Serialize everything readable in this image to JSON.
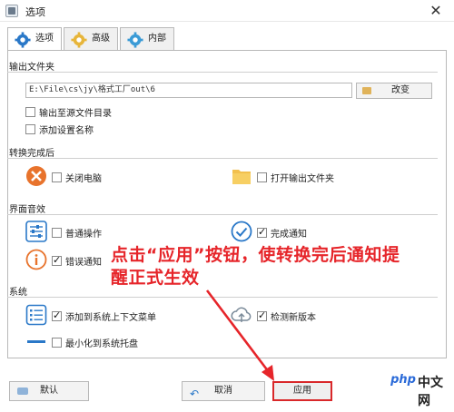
{
  "window": {
    "title": "选项",
    "close_glyph": "✕"
  },
  "tabs": [
    {
      "label": "选项",
      "icon": "gear-icon",
      "active": true
    },
    {
      "label": "高级",
      "icon": "advanced-gear-icon",
      "active": false
    },
    {
      "label": "内部",
      "icon": "internal-gear-icon",
      "active": false
    }
  ],
  "output_folder": {
    "title": "输出文件夹",
    "path_value": "E:\\File\\cs\\jy\\格式工厂out\\6",
    "browse_label": "改变",
    "opt_source_dir": "输出至源文件目录",
    "opt_add_setting_name": "添加设置名称"
  },
  "after_convert": {
    "title": "转换完成后",
    "shutdown": "关闭电脑",
    "open_folder": "打开输出文件夹"
  },
  "ui_sound": {
    "title": "界面音效",
    "normal_op": "普通操作",
    "done_notify": "完成通知",
    "error_notify": "错误通知"
  },
  "system": {
    "title": "系统",
    "add_context_menu": "添加到系统上下文菜单",
    "check_update": "检测新版本",
    "minimize_tray": "最小化到系统托盘"
  },
  "buttons": {
    "default": "默认",
    "cancel": "取消",
    "apply": "应用"
  },
  "annotation": {
    "line1": "点击“应用”按钮，使转换完后通知提",
    "line2": "醒正式生效"
  },
  "watermark": {
    "logo": "php",
    "text": "中文网"
  },
  "colors": {
    "annotation_red": "#e6252a",
    "accent_blue": "#2a78c8",
    "warning_orange": "#e8732c"
  }
}
